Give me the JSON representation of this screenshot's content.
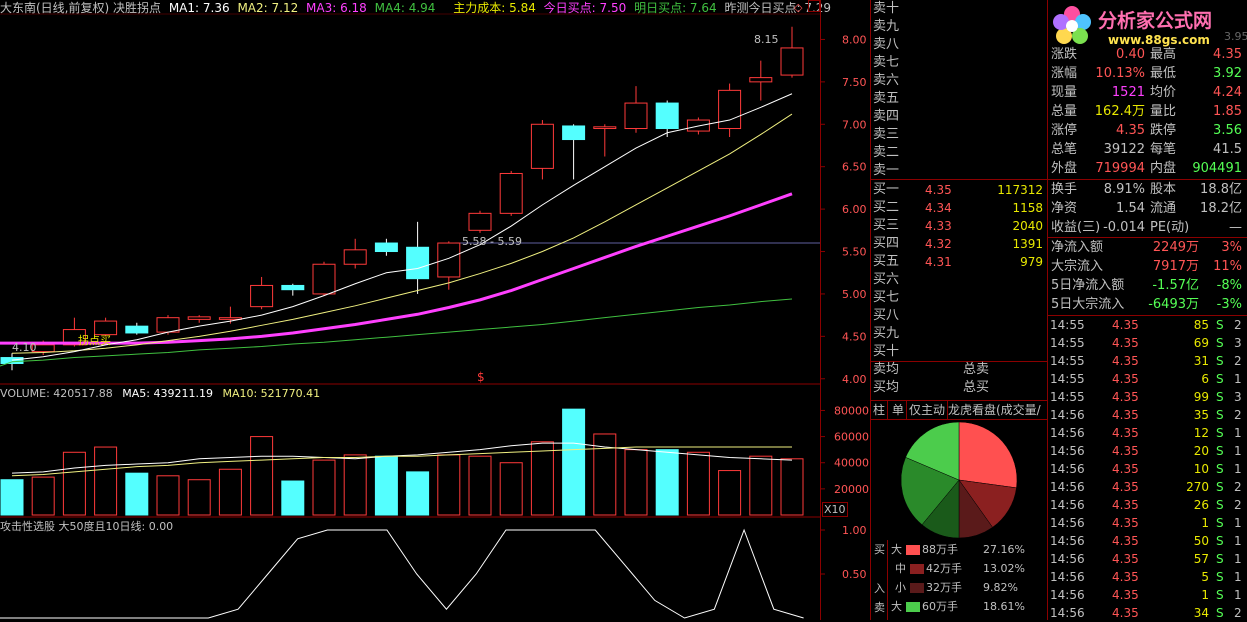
{
  "header": {
    "title": "大东南(日线,前复权) 决胜拐点",
    "ma1": "MA1: 7.36",
    "ma2": "MA2: 7.12",
    "ma3": "MA3: 6.18",
    "ma4": "MA4: 4.94",
    "cost": "主力成本: 5.84",
    "buy_today": "今日买点: 7.50",
    "buy_tomorrow": "明日买点: 7.64",
    "pred_today": "昨测今日买点: 7.29"
  },
  "colors": {
    "up": "#ff3a3a",
    "down": "#54ffff",
    "ma1": "#ffffff",
    "ma2": "#f0f080",
    "ma3": "#ff40ff",
    "ma4": "#40c040",
    "grid": "#8b0000",
    "yellow": "#e8e800"
  },
  "price_axis": {
    "labels": [
      "8.00",
      "7.50",
      "7.00",
      "6.50",
      "6.00",
      "5.50",
      "5.00",
      "4.50",
      "4.00"
    ]
  },
  "annotations": {
    "high_label": "8.15",
    "low_label": "4.10",
    "mid_label": "5.58 - 5.59",
    "buy_label": "拐点买",
    "marker": "$"
  },
  "chart_data": {
    "type": "candlestick",
    "candles": [
      {
        "o": 4.25,
        "c": 4.18,
        "h": 4.3,
        "l": 4.1
      },
      {
        "o": 4.32,
        "c": 4.4,
        "h": 4.45,
        "l": 4.28
      },
      {
        "o": 4.4,
        "c": 4.58,
        "h": 4.72,
        "l": 4.38
      },
      {
        "o": 4.52,
        "c": 4.68,
        "h": 4.72,
        "l": 4.5
      },
      {
        "o": 4.62,
        "c": 4.54,
        "h": 4.66,
        "l": 4.52
      },
      {
        "o": 4.55,
        "c": 4.72,
        "h": 4.75,
        "l": 4.52
      },
      {
        "o": 4.7,
        "c": 4.73,
        "h": 4.75,
        "l": 4.66
      },
      {
        "o": 4.7,
        "c": 4.72,
        "h": 4.85,
        "l": 4.65
      },
      {
        "o": 4.85,
        "c": 5.1,
        "h": 5.2,
        "l": 4.82
      },
      {
        "o": 5.1,
        "c": 5.05,
        "h": 5.12,
        "l": 4.98
      },
      {
        "o": 5.0,
        "c": 5.35,
        "h": 5.38,
        "l": 4.98
      },
      {
        "o": 5.35,
        "c": 5.52,
        "h": 5.65,
        "l": 5.3
      },
      {
        "o": 5.6,
        "c": 5.5,
        "h": 5.65,
        "l": 5.45
      },
      {
        "o": 5.55,
        "c": 5.18,
        "h": 5.85,
        "l": 5.0
      },
      {
        "o": 5.2,
        "c": 5.6,
        "h": 5.62,
        "l": 5.05
      },
      {
        "o": 5.75,
        "c": 5.95,
        "h": 5.98,
        "l": 5.72
      },
      {
        "o": 5.95,
        "c": 6.42,
        "h": 6.45,
        "l": 5.92
      },
      {
        "o": 6.48,
        "c": 7.0,
        "h": 7.05,
        "l": 6.35
      },
      {
        "o": 6.98,
        "c": 6.82,
        "h": 7.0,
        "l": 6.35
      },
      {
        "o": 6.95,
        "c": 6.97,
        "h": 7.0,
        "l": 6.62
      },
      {
        "o": 6.95,
        "c": 7.25,
        "h": 7.45,
        "l": 6.9
      },
      {
        "o": 7.25,
        "c": 6.95,
        "h": 7.28,
        "l": 6.85
      },
      {
        "o": 6.92,
        "c": 7.05,
        "h": 7.08,
        "l": 6.88
      },
      {
        "o": 6.95,
        "c": 7.4,
        "h": 7.48,
        "l": 6.85
      },
      {
        "o": 7.5,
        "c": 7.55,
        "h": 7.75,
        "l": 7.28
      },
      {
        "o": 7.58,
        "c": 7.9,
        "h": 8.15,
        "l": 7.55
      }
    ],
    "ma1": [
      4.22,
      4.26,
      4.32,
      4.4,
      4.46,
      4.55,
      4.62,
      4.68,
      4.75,
      4.85,
      4.98,
      5.12,
      5.25,
      5.3,
      5.42,
      5.58,
      5.8,
      6.05,
      6.28,
      6.5,
      6.72,
      6.9,
      6.98,
      7.05,
      7.2,
      7.36
    ],
    "ma2": [
      4.3,
      4.31,
      4.33,
      4.36,
      4.4,
      4.45,
      4.5,
      4.56,
      4.63,
      4.7,
      4.78,
      4.86,
      4.95,
      5.04,
      5.13,
      5.24,
      5.36,
      5.5,
      5.66,
      5.85,
      6.05,
      6.25,
      6.45,
      6.65,
      6.88,
      7.12
    ],
    "ma3": [
      4.42,
      4.42,
      4.42,
      4.42,
      4.42,
      4.43,
      4.45,
      4.47,
      4.5,
      4.54,
      4.59,
      4.64,
      4.7,
      4.76,
      4.84,
      4.93,
      5.04,
      5.17,
      5.3,
      5.43,
      5.56,
      5.68,
      5.8,
      5.92,
      6.05,
      6.18
    ],
    "ma4": [
      4.2,
      4.22,
      4.25,
      4.27,
      4.29,
      4.31,
      4.34,
      4.36,
      4.38,
      4.41,
      4.43,
      4.46,
      4.49,
      4.52,
      4.55,
      4.58,
      4.61,
      4.64,
      4.68,
      4.72,
      4.76,
      4.8,
      4.84,
      4.87,
      4.91,
      4.94
    ],
    "volume": [
      27000,
      29000,
      48000,
      52000,
      32000,
      30000,
      27000,
      35000,
      60000,
      26000,
      42000,
      46000,
      45000,
      33000,
      46000,
      45000,
      40000,
      56000,
      81000,
      62000,
      50000,
      50000,
      48000,
      34000,
      45000,
      43000
    ],
    "vol_ma5": [
      32000,
      33000,
      36000,
      38000,
      39000,
      40000,
      43000,
      44000,
      45000,
      45000,
      44000,
      43000,
      45000,
      46000,
      48000,
      50000,
      53000,
      55000,
      55000,
      52000,
      50000,
      48000,
      46000,
      44000,
      43000,
      42000
    ],
    "vol_ma10": [
      30000,
      31000,
      33000,
      35000,
      37000,
      38000,
      40000,
      41000,
      42000,
      43000,
      44000,
      44000,
      45000,
      45000,
      46000,
      47000,
      48000,
      49000,
      50000,
      51000,
      52000,
      52000,
      52000,
      52000,
      52000,
      52000
    ],
    "vol_labels": [
      "80000",
      "60000",
      "40000",
      "20000"
    ],
    "osc": [
      0,
      0,
      0,
      0,
      0,
      0,
      0,
      0,
      0.1,
      0.5,
      0.9,
      1,
      1,
      1,
      0.5,
      0.1,
      0.5,
      1,
      1,
      1,
      1,
      0.6,
      0.2,
      0,
      0.1,
      1,
      0.1,
      0
    ],
    "osc_labels": [
      "1.00",
      "0.50"
    ]
  },
  "volume_header": {
    "label": "VOLUME: 420517.88",
    "ma5": "MA5: 439211.19",
    "ma10": "MA10: 521770.41",
    "x10": "X10"
  },
  "osc_header": {
    "label": "攻击性选股  大50度且10日线: 0.00"
  },
  "order_book": {
    "sell": [
      "卖十",
      "卖九",
      "卖八",
      "卖七",
      "卖六",
      "卖五",
      "卖四",
      "卖三",
      "卖二",
      "卖一"
    ],
    "buy": [
      {
        "label": "买一",
        "price": "4.35",
        "vol": "117312"
      },
      {
        "label": "买二",
        "price": "4.34",
        "vol": "1158"
      },
      {
        "label": "买三",
        "price": "4.33",
        "vol": "2040"
      },
      {
        "label": "买四",
        "price": "4.32",
        "vol": "1391"
      },
      {
        "label": "买五",
        "price": "4.31",
        "vol": "979"
      },
      {
        "label": "买六",
        "price": "",
        "vol": ""
      },
      {
        "label": "买七",
        "price": "",
        "vol": ""
      },
      {
        "label": "买八",
        "price": "",
        "vol": ""
      },
      {
        "label": "买九",
        "price": "",
        "vol": ""
      },
      {
        "label": "买十",
        "price": "",
        "vol": ""
      }
    ],
    "avg_sell": "卖均",
    "total_sell": "总卖",
    "avg_buy": "买均",
    "total_buy": "总买"
  },
  "tabs": [
    "柱",
    "单",
    "仅主动",
    "龙虎看盘(成交量/按"
  ],
  "pie": {
    "slices": [
      {
        "pct": 27.16,
        "color": "#ff5050"
      },
      {
        "pct": 13.02,
        "color": "#8b2020"
      },
      {
        "pct": 9.82,
        "color": "#5a1a1a"
      },
      {
        "pct": 11.0,
        "color": "#1a5a1a"
      },
      {
        "pct": 20.39,
        "color": "#2a8a2a"
      },
      {
        "pct": 18.61,
        "color": "#4ccc4c"
      }
    ]
  },
  "legend": {
    "buy": "买",
    "in": "入",
    "sell": "卖",
    "rows": [
      {
        "k": "大",
        "color": "#ff5050",
        "amt": "88万手",
        "pct": "27.16%"
      },
      {
        "k": "中",
        "color": "#8b2020",
        "amt": "42万手",
        "pct": "13.02%"
      },
      {
        "k": "小",
        "color": "#5a1a1a",
        "amt": "32万手",
        "pct": "9.82%"
      },
      {
        "k": "大",
        "color": "#4ccc4c",
        "amt": "60万手",
        "pct": "18.61%"
      }
    ]
  },
  "logo": {
    "text": "分析家公式网",
    "url": "www.88gs.com",
    "partial": "3.95"
  },
  "stats": [
    {
      "k1": "涨跌",
      "v1": "0.40",
      "c1": "#ff5555",
      "k2": "最高",
      "v2": "4.35",
      "c2": "#ff5555"
    },
    {
      "k1": "涨幅",
      "v1": "10.13%",
      "c1": "#ff5555",
      "k2": "最低",
      "v2": "3.92",
      "c2": "#55ff55"
    },
    {
      "k1": "现量",
      "v1": "1521",
      "c1": "#ff40ff",
      "k2": "均价",
      "v2": "4.24",
      "c2": "#ff5555"
    },
    {
      "k1": "总量",
      "v1": "162.4万",
      "c1": "#e8e800",
      "k2": "量比",
      "v2": "1.85",
      "c2": "#ff5555"
    },
    {
      "k1": "涨停",
      "v1": "4.35",
      "c1": "#ff5555",
      "k2": "跌停",
      "v2": "3.56",
      "c2": "#55ff55"
    },
    {
      "k1": "总笔",
      "v1": "39122",
      "c1": "#c0c0c0",
      "k2": "每笔",
      "v2": "41.5",
      "c2": "#c0c0c0"
    },
    {
      "k1": "外盘",
      "v1": "719994",
      "c1": "#ff5555",
      "k2": "内盘",
      "v2": "904491",
      "c2": "#55ff55"
    }
  ],
  "stats2": [
    {
      "k1": "换手",
      "v1": "8.91%",
      "c1": "#c0c0c0",
      "k2": "股本",
      "v2": "18.8亿",
      "c2": "#c0c0c0"
    },
    {
      "k1": "净资",
      "v1": "1.54",
      "c1": "#c0c0c0",
      "k2": "流通",
      "v2": "18.2亿",
      "c2": "#c0c0c0"
    },
    {
      "k1": "收益(三)",
      "v1": "-0.014",
      "c1": "#c0c0c0",
      "k2": "PE(动)",
      "v2": "—",
      "c2": "#c0c0c0"
    }
  ],
  "flows": [
    {
      "k": "净流入额",
      "v": "2249万",
      "p": "3%",
      "cv": "#ff5555",
      "cp": "#ff5555"
    },
    {
      "k": "大宗流入",
      "v": "7917万",
      "p": "11%",
      "cv": "#ff5555",
      "cp": "#ff5555"
    },
    {
      "k": "5日净流入额",
      "v": "-1.57亿",
      "p": "-8%",
      "cv": "#55ff55",
      "cp": "#55ff55"
    },
    {
      "k": "5日大宗流入",
      "v": "-6493万",
      "p": "-3%",
      "cv": "#55ff55",
      "cp": "#55ff55"
    }
  ],
  "trades": [
    {
      "t": "14:55",
      "p": "4.35",
      "v": "85",
      "s": "S",
      "n": "2"
    },
    {
      "t": "14:55",
      "p": "4.35",
      "v": "69",
      "s": "S",
      "n": "3"
    },
    {
      "t": "14:55",
      "p": "4.35",
      "v": "31",
      "s": "S",
      "n": "2"
    },
    {
      "t": "14:55",
      "p": "4.35",
      "v": "6",
      "s": "S",
      "n": "1"
    },
    {
      "t": "14:55",
      "p": "4.35",
      "v": "99",
      "s": "S",
      "n": "3"
    },
    {
      "t": "14:56",
      "p": "4.35",
      "v": "35",
      "s": "S",
      "n": "2"
    },
    {
      "t": "14:56",
      "p": "4.35",
      "v": "12",
      "s": "S",
      "n": "1"
    },
    {
      "t": "14:56",
      "p": "4.35",
      "v": "20",
      "s": "S",
      "n": "1"
    },
    {
      "t": "14:56",
      "p": "4.35",
      "v": "10",
      "s": "S",
      "n": "1"
    },
    {
      "t": "14:56",
      "p": "4.35",
      "v": "270",
      "s": "S",
      "n": "2"
    },
    {
      "t": "14:56",
      "p": "4.35",
      "v": "26",
      "s": "S",
      "n": "2"
    },
    {
      "t": "14:56",
      "p": "4.35",
      "v": "1",
      "s": "S",
      "n": "1"
    },
    {
      "t": "14:56",
      "p": "4.35",
      "v": "50",
      "s": "S",
      "n": "1"
    },
    {
      "t": "14:56",
      "p": "4.35",
      "v": "57",
      "s": "S",
      "n": "1"
    },
    {
      "t": "14:56",
      "p": "4.35",
      "v": "5",
      "s": "S",
      "n": "1"
    },
    {
      "t": "14:56",
      "p": "4.35",
      "v": "1",
      "s": "S",
      "n": "1"
    },
    {
      "t": "14:56",
      "p": "4.35",
      "v": "34",
      "s": "S",
      "n": "2"
    }
  ]
}
